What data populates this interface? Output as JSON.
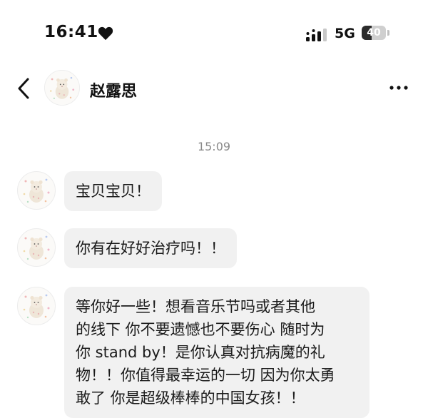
{
  "status_bar": {
    "time": "16:41",
    "heart_icon": "heart-icon",
    "signal_icon": "signal-icon",
    "network": "5G",
    "battery_level": "40"
  },
  "header": {
    "contact_name": "赵露思",
    "back_icon": "chevron-left-icon",
    "more_icon": "more-horizontal-icon"
  },
  "conversation": {
    "timestamp": "15:09",
    "messages": [
      {
        "text": "宝贝宝贝！"
      },
      {
        "text": "你有在好好治疗吗！！"
      },
      {
        "text": "等你好一些！想看音乐节吗或者其他\n的线下 你不要遗憾也不要伤心 随时为\n你 stand by！是你认真对抗病魔的礼\n物！！你值得最幸运的一切 因为你太勇\n敢了 你是超级棒棒的中国女孩！！"
      }
    ]
  },
  "colors": {
    "bubble_background": "#f1f1f1",
    "timestamp_text": "#8a8a8a",
    "primary_text": "#111111"
  }
}
